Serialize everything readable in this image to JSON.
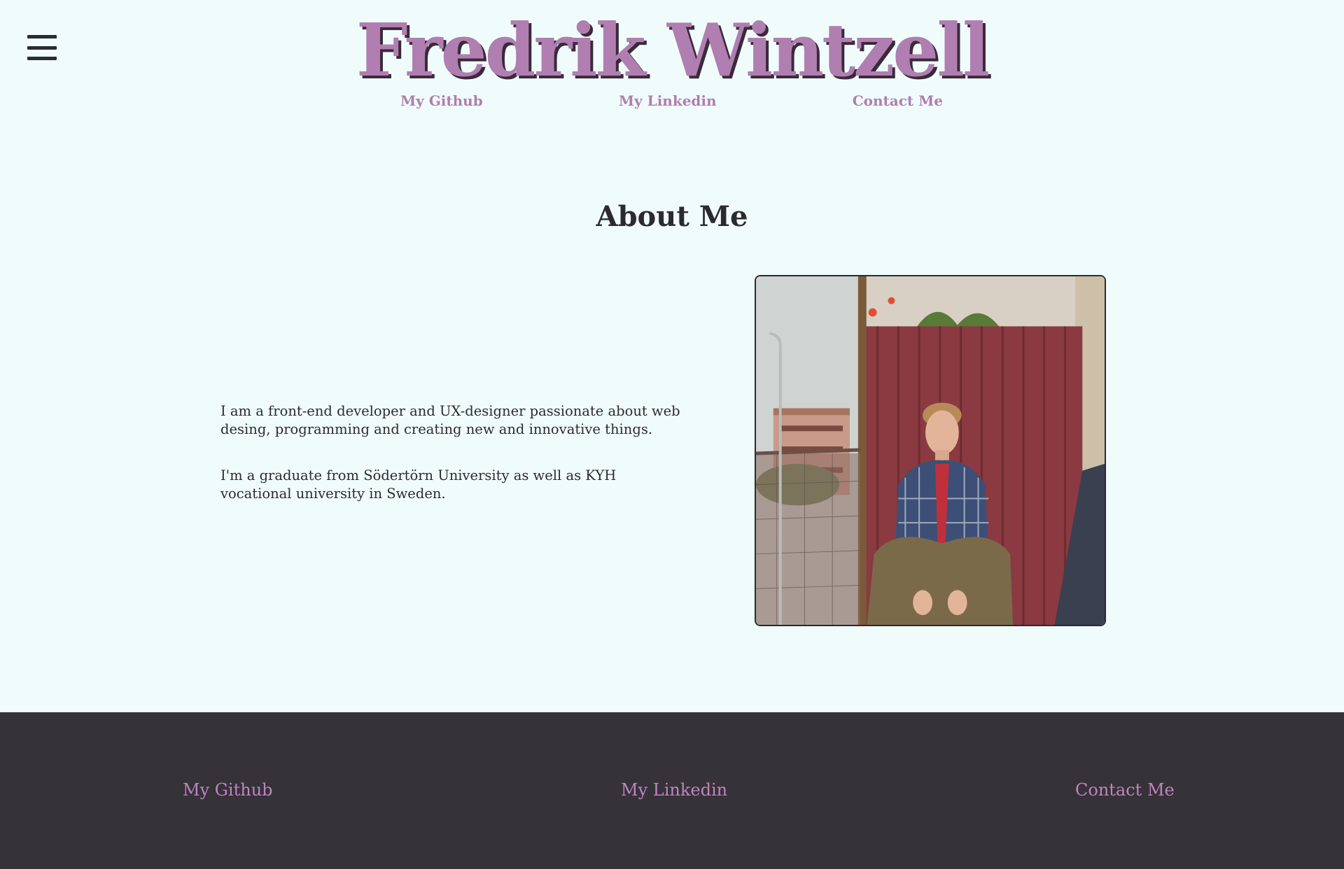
{
  "header": {
    "menu_icon": "hamburger-menu-icon",
    "title": "Fredrik Wintzell",
    "nav": [
      {
        "label": "My Github"
      },
      {
        "label": "My Linkedin"
      },
      {
        "label": "Contact Me"
      }
    ]
  },
  "about": {
    "heading": "About Me",
    "paragraphs": [
      "I am a front-end developer and UX-designer passionate about web desing, programming and creating new and innovative things.",
      "I'm a graduate from Södertörn University as well as KYH vocational university in Sweden."
    ],
    "photo": "profile-photo"
  },
  "footer": {
    "links": [
      {
        "label": "My Github"
      },
      {
        "label": "My Linkedin"
      },
      {
        "label": "Contact Me"
      }
    ]
  },
  "colors": {
    "background": "#f0fcfc",
    "accent": "#b07eb0",
    "footer_bg": "#353238",
    "text": "#2c2a30"
  }
}
